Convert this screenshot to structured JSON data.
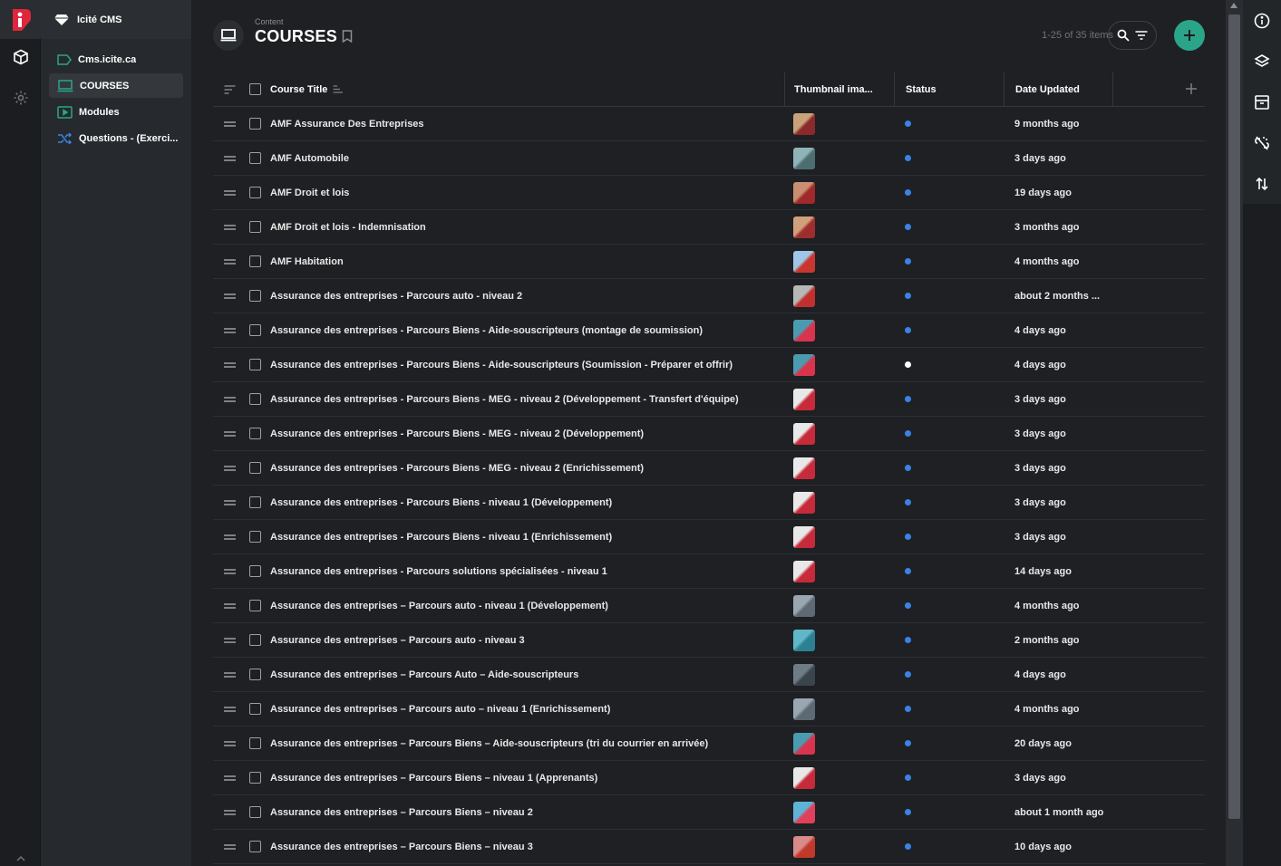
{
  "project": {
    "name": "Icité CMS"
  },
  "sidebar": {
    "items": [
      {
        "label": "Cms.icite.ca",
        "icon": "tag-icon"
      },
      {
        "label": "COURSES",
        "icon": "monitor-icon",
        "active": true
      },
      {
        "label": "Modules",
        "icon": "play-icon"
      },
      {
        "label": "Questions - (Exerci...",
        "icon": "shuffle-icon"
      }
    ]
  },
  "header": {
    "subtitle": "Content",
    "title": "COURSES",
    "count": "1-25 of 35 items"
  },
  "table": {
    "columns": {
      "title": "Course Title",
      "thumbnail": "Thumbnail ima...",
      "status": "Status",
      "date": "Date Updated"
    },
    "rows": [
      {
        "title": "AMF Assurance Des Entreprises",
        "date": "9 months ago",
        "status": "published",
        "thumb": [
          "#c9a27a",
          "#8a2a2a"
        ]
      },
      {
        "title": "AMF Automobile",
        "date": "3 days ago",
        "status": "published",
        "thumb": [
          "#8fb3b8",
          "#4d6e70"
        ]
      },
      {
        "title": "AMF Droit et lois",
        "date": "19 days ago",
        "status": "published",
        "thumb": [
          "#c98f72",
          "#a02a2a"
        ]
      },
      {
        "title": "AMF Droit et lois - Indemnisation",
        "date": "3 months ago",
        "status": "published",
        "thumb": [
          "#d1a07b",
          "#9e2e2e"
        ]
      },
      {
        "title": "AMF Habitation",
        "date": "4 months ago",
        "status": "published",
        "thumb": [
          "#9fc6e6",
          "#c7372f"
        ]
      },
      {
        "title": "Assurance des entreprises - Parcours auto - niveau 2",
        "date": "about 2 months ...",
        "status": "published",
        "thumb": [
          "#b7b7b7",
          "#c12f2f"
        ]
      },
      {
        "title": "Assurance des entreprises - Parcours Biens - Aide-souscripteurs (montage de soumission)",
        "date": "4 days ago",
        "status": "published",
        "thumb": [
          "#4a9bb0",
          "#d8344e"
        ]
      },
      {
        "title": "Assurance des entreprises - Parcours Biens - Aide-souscripteurs (Soumission - Préparer et offrir)",
        "date": "4 days ago",
        "status": "draft",
        "thumb": [
          "#4a9bb0",
          "#d8344e"
        ]
      },
      {
        "title": "Assurance des entreprises - Parcours Biens - MEG - niveau 2 (Développement - Transfert d'équipe)",
        "date": "3 days ago",
        "status": "published",
        "thumb": [
          "#e8e8e8",
          "#c72a3a"
        ]
      },
      {
        "title": "Assurance des entreprises - Parcours Biens - MEG - niveau 2 (Développement)",
        "date": "3 days ago",
        "status": "published",
        "thumb": [
          "#e8e8e8",
          "#c72a3a"
        ]
      },
      {
        "title": "Assurance des entreprises - Parcours Biens - MEG - niveau 2 (Enrichissement)",
        "date": "3 days ago",
        "status": "published",
        "thumb": [
          "#e8e8e8",
          "#c72a3a"
        ]
      },
      {
        "title": "Assurance des entreprises - Parcours Biens - niveau 1 (Développement)",
        "date": "3 days ago",
        "status": "published",
        "thumb": [
          "#e8e8e8",
          "#c72a3a"
        ]
      },
      {
        "title": "Assurance des entreprises - Parcours Biens - niveau 1 (Enrichissement)",
        "date": "3 days ago",
        "status": "published",
        "thumb": [
          "#e8e8e8",
          "#c72a3a"
        ]
      },
      {
        "title": "Assurance des entreprises - Parcours solutions spécialisées - niveau 1",
        "date": "14 days ago",
        "status": "published",
        "thumb": [
          "#e8e8e8",
          "#c72a3a"
        ]
      },
      {
        "title": "Assurance des entreprises – Parcours auto - niveau 1 (Développement)",
        "date": "4 months ago",
        "status": "published",
        "thumb": [
          "#9aa7b0",
          "#5d6a73"
        ]
      },
      {
        "title": "Assurance des entreprises – Parcours auto - niveau 3",
        "date": "2 months ago",
        "status": "published",
        "thumb": [
          "#5fb8c8",
          "#2d7f92"
        ]
      },
      {
        "title": "Assurance des entreprises – Parcours Auto – Aide-souscripteurs",
        "date": "4 days ago",
        "status": "published",
        "thumb": [
          "#6e7c86",
          "#3a444b"
        ]
      },
      {
        "title": "Assurance des entreprises – Parcours auto – niveau 1 (Enrichissement)",
        "date": "4 months ago",
        "status": "published",
        "thumb": [
          "#9aa7b0",
          "#5d6a73"
        ]
      },
      {
        "title": "Assurance des entreprises – Parcours Biens – Aide-souscripteurs (tri du courrier en arrivée)",
        "date": "20 days ago",
        "status": "published",
        "thumb": [
          "#4a9bb0",
          "#d8344e"
        ]
      },
      {
        "title": "Assurance des entreprises – Parcours Biens – niveau 1 (Apprenants)",
        "date": "3 days ago",
        "status": "published",
        "thumb": [
          "#e8e8e8",
          "#c72a3a"
        ]
      },
      {
        "title": "Assurance des entreprises – Parcours Biens – niveau 2",
        "date": "about 1 month ago",
        "status": "published",
        "thumb": [
          "#5fb3d6",
          "#e0415a"
        ]
      },
      {
        "title": "Assurance des entreprises – Parcours Biens – niveau 3",
        "date": "10 days ago",
        "status": "published",
        "thumb": [
          "#d98a8a",
          "#c0392b"
        ]
      }
    ]
  },
  "colors": {
    "accent": "#2aa58a",
    "status_published": "#3b82e6",
    "status_draft": "#ffffff",
    "brand": "#e0263c"
  }
}
